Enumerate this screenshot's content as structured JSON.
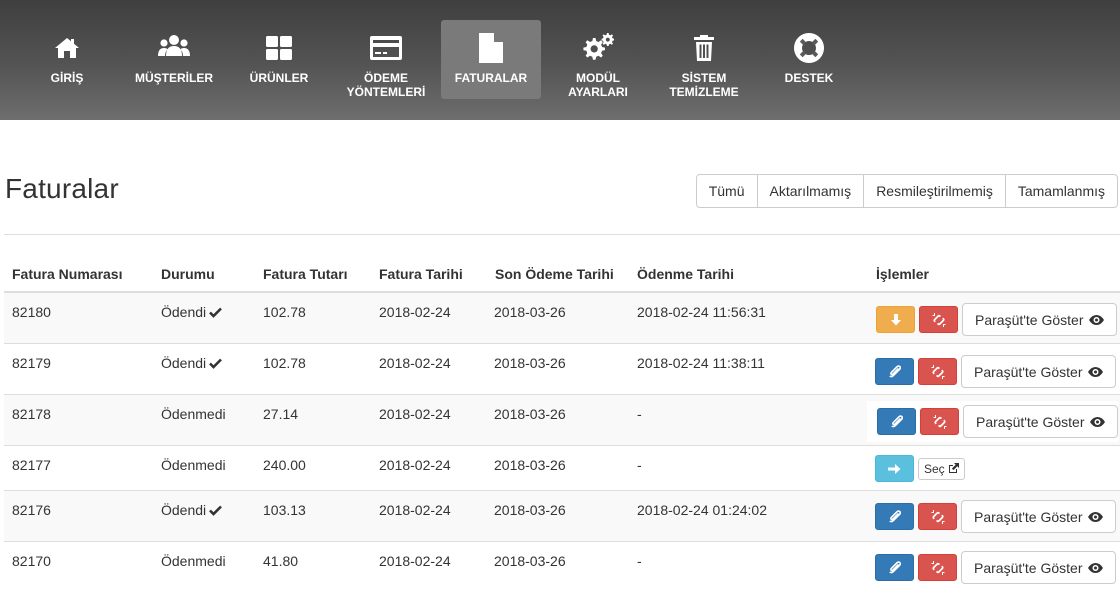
{
  "nav": {
    "items": [
      {
        "label": "GİRİŞ",
        "icon": "home-icon"
      },
      {
        "label": "MÜŞTERİLER",
        "icon": "users-icon"
      },
      {
        "label": "ÜRÜNLER",
        "icon": "grid-icon"
      },
      {
        "label": "ÖDEME\nYÖNTEMLERİ",
        "icon": "credit-card-icon"
      },
      {
        "label": "FATURALAR",
        "icon": "document-icon",
        "active": true
      },
      {
        "label": "MODÜL\nAYARLARI",
        "icon": "gears-icon"
      },
      {
        "label": "SİSTEM\nTEMİZLEME",
        "icon": "trash-icon"
      },
      {
        "label": "DESTEK",
        "icon": "lifebuoy-icon"
      }
    ]
  },
  "page": {
    "title": "Faturalar"
  },
  "filters": [
    "Tümü",
    "Aktarılmamış",
    "Resmileştirilmemiş",
    "Tamamlanmış"
  ],
  "table": {
    "headers": [
      "Fatura Numarası",
      "Durumu",
      "Fatura Tutarı",
      "Fatura Tarihi",
      "Son Ödeme Tarihi",
      "Ödenme Tarihi",
      "İşlemler"
    ],
    "rows": [
      {
        "number": "82180",
        "status": "Ödendi",
        "paid": true,
        "amount": "102.78",
        "invoice_date": "2018-02-24",
        "due_date": "2018-03-26",
        "paid_date": "2018-02-24 11:56:31",
        "actions": "download"
      },
      {
        "number": "82179",
        "status": "Ödendi",
        "paid": true,
        "amount": "102.78",
        "invoice_date": "2018-02-24",
        "due_date": "2018-03-26",
        "paid_date": "2018-02-24 11:38:11",
        "actions": "attach"
      },
      {
        "number": "82178",
        "status": "Ödenmedi",
        "paid": false,
        "amount": "27.14",
        "invoice_date": "2018-02-24",
        "due_date": "2018-03-26",
        "paid_date": "-",
        "actions": "attach"
      },
      {
        "number": "82177",
        "status": "Ödenmedi",
        "paid": false,
        "amount": "240.00",
        "invoice_date": "2018-02-24",
        "due_date": "2018-03-26",
        "paid_date": "-",
        "actions": "select"
      },
      {
        "number": "82176",
        "status": "Ödendi",
        "paid": true,
        "amount": "103.13",
        "invoice_date": "2018-02-24",
        "due_date": "2018-03-26",
        "paid_date": "2018-02-24 01:24:02",
        "actions": "attach"
      },
      {
        "number": "82170",
        "status": "Ödenmedi",
        "paid": false,
        "amount": "41.80",
        "invoice_date": "2018-02-24",
        "due_date": "2018-03-26",
        "paid_date": "-",
        "actions": "attach"
      }
    ],
    "show_label": "Paraşüt'te Göster",
    "select_label": "Seç"
  },
  "colors": {
    "accent_orange": "#f0ad4e",
    "danger_red": "#d9534f",
    "primary_blue": "#337ab7",
    "info_cyan": "#5bc0de"
  }
}
